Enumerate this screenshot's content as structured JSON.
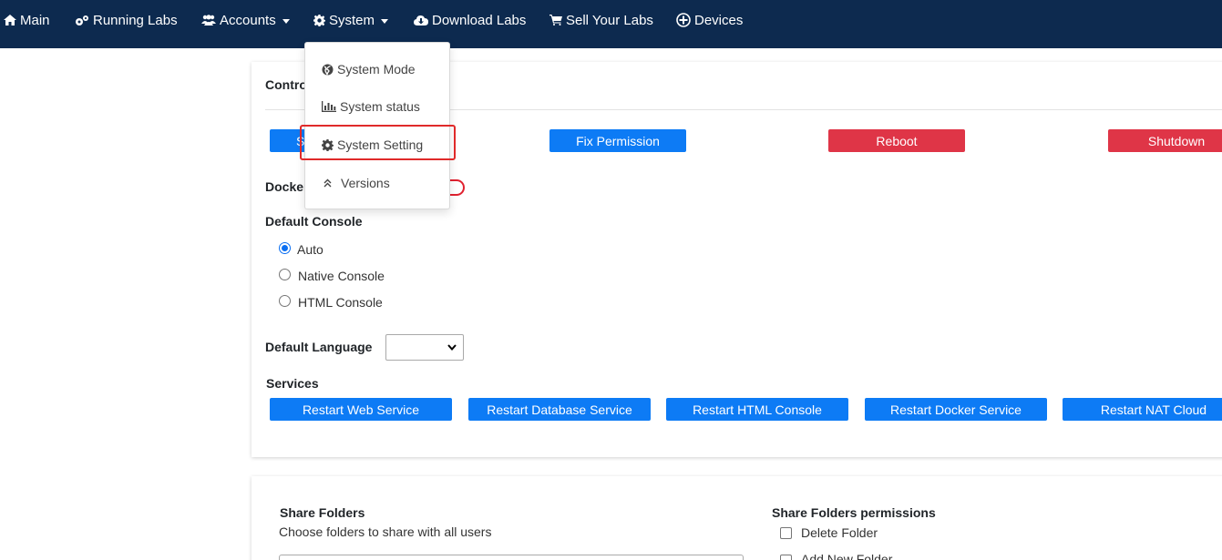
{
  "nav": {
    "main": "Main",
    "running_labs": "Running Labs",
    "accounts": "Accounts",
    "system": "System",
    "download_labs": "Download Labs",
    "sell_your_labs": "Sell Your Labs",
    "devices": "Devices"
  },
  "system_menu": {
    "items": [
      {
        "label": "System Mode",
        "icon": "globe-icon"
      },
      {
        "label": "System status",
        "icon": "bar-chart-icon"
      },
      {
        "label": "System Setting",
        "icon": "gear-icon",
        "highlighted": true
      },
      {
        "label": "Versions",
        "icon": "double-chevron-up-icon"
      }
    ]
  },
  "control": {
    "title_partial": "Contro",
    "first_button_partial": "S",
    "fix_permission": "Fix Permission",
    "reboot": "Reboot",
    "shutdown": "Shutdown"
  },
  "docker": {
    "label_partial": "Docker"
  },
  "default_console": {
    "title": "Default Console",
    "options": [
      {
        "label": "Auto",
        "selected": true
      },
      {
        "label": "Native Console",
        "selected": false
      },
      {
        "label": "HTML Console",
        "selected": false
      }
    ]
  },
  "default_language": {
    "label": "Default Language",
    "value": ""
  },
  "services": {
    "title": "Services",
    "buttons": [
      "Restart Web Service",
      "Restart Database Service",
      "Restart HTML Console",
      "Restart Docker Service",
      "Restart NAT Cloud"
    ]
  },
  "share_folders": {
    "title": "Share Folders",
    "description": "Choose folders to share with all users",
    "permissions_title": "Share Folders permissions",
    "permissions": [
      "Delete Folder",
      "Add New Folder"
    ]
  },
  "colors": {
    "navbar": "#0d2a4f",
    "primary": "#0d7bf5",
    "danger": "#df3547",
    "highlight": "#e02a2a"
  }
}
